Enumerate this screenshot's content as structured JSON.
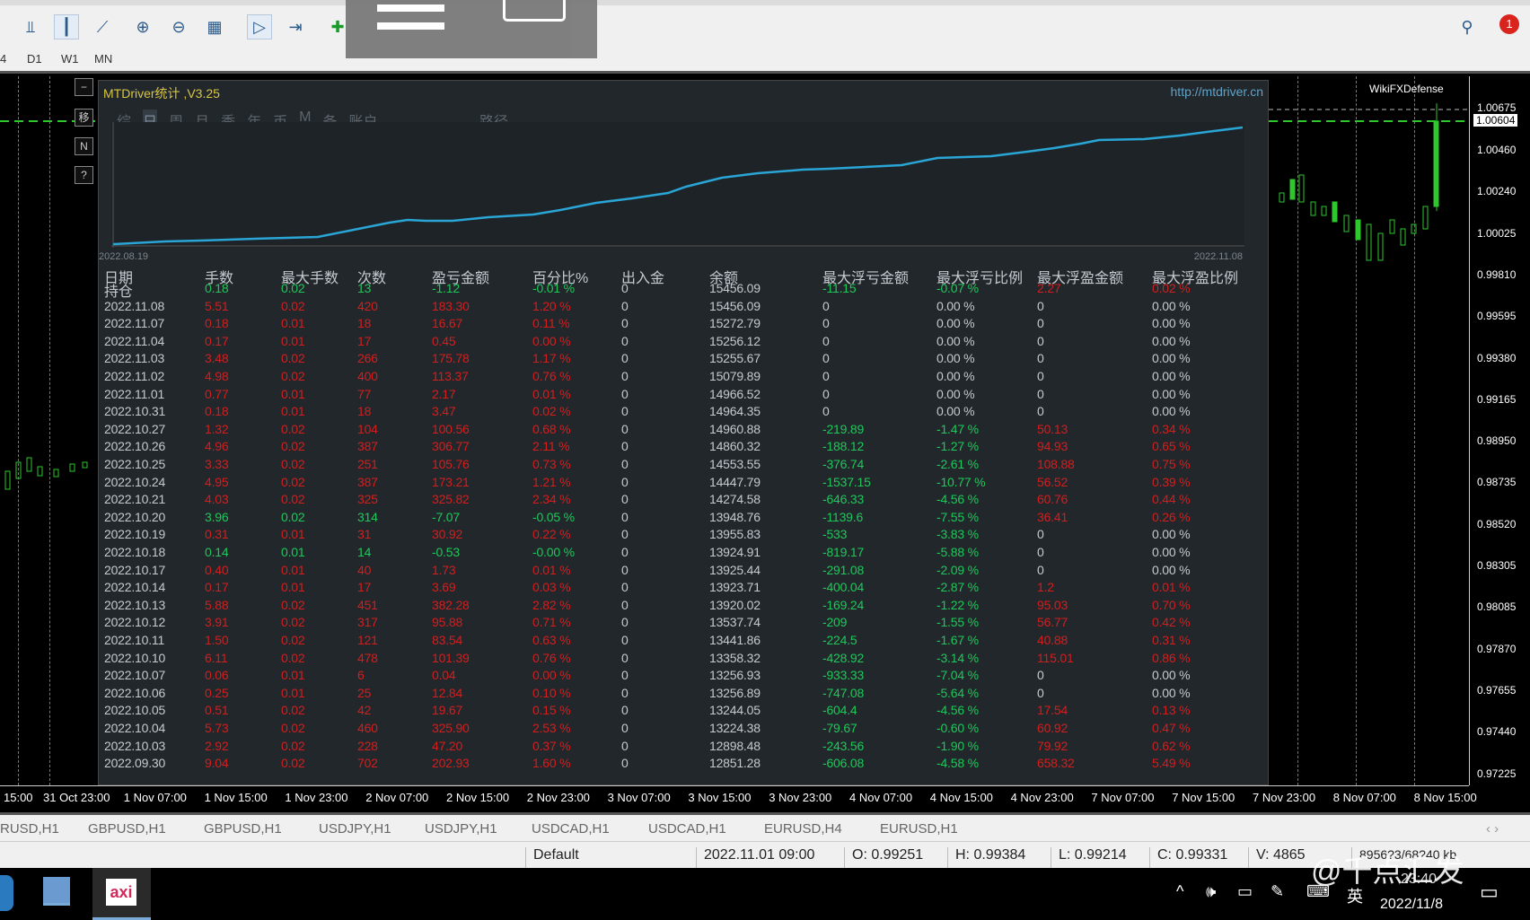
{
  "toolbar": {
    "timeframes": [
      "4",
      "D1",
      "W1",
      "MN"
    ],
    "notification_count": "1"
  },
  "panel": {
    "title": "MTDriver统计 ,V3.25",
    "url": "http://mtdriver.cn",
    "tabs": [
      "综",
      "日",
      "周",
      "月",
      "季",
      "年",
      "币",
      "M",
      "备",
      "账户"
    ],
    "selected_tab": "日",
    "path_label": "路径",
    "chart_start": "2022.08.19",
    "chart_end": "2022.11.08"
  },
  "chart_watermark": "WikiFXDefense",
  "price_axis": [
    "1.00675",
    "1.00604",
    "1.00460",
    "1.00240",
    "1.00025",
    "0.99810",
    "0.99595",
    "0.99380",
    "0.99165",
    "0.98950",
    "0.98735",
    "0.98520",
    "0.98305",
    "0.98085",
    "0.97870",
    "0.97655",
    "0.97440",
    "0.97225"
  ],
  "time_axis": [
    "15:00",
    "31 Oct 23:00",
    "1 Nov 07:00",
    "1 Nov 15:00",
    "1 Nov 23:00",
    "2 Nov 07:00",
    "2 Nov 15:00",
    "2 Nov 23:00",
    "3 Nov 07:00",
    "3 Nov 15:00",
    "3 Nov 23:00",
    "4 Nov 07:00",
    "4 Nov 15:00",
    "4 Nov 23:00",
    "7 Nov 07:00",
    "7 Nov 15:00",
    "7 Nov 23:00",
    "8 Nov 07:00",
    "8 Nov 15:00"
  ],
  "table": {
    "headers": [
      "日期",
      "手数",
      "最大手数",
      "次数",
      "盈亏金额",
      "百分比%",
      "出入金",
      "余额",
      "最大浮亏金额",
      "最大浮亏比例",
      "最大浮盈金额",
      "最大浮盈比例"
    ],
    "rows": [
      [
        "持仓",
        "0.18",
        "0.02",
        "13",
        "-1.12",
        "-0.01 %",
        "0",
        "15456.09",
        "-11.15",
        "-0.07 %",
        "2.27",
        "0.02 %"
      ],
      [
        "2022.11.08",
        "5.51",
        "0.02",
        "420",
        "183.30",
        "1.20 %",
        "0",
        "15456.09",
        "0",
        "0.00 %",
        "0",
        "0.00 %"
      ],
      [
        "2022.11.07",
        "0.18",
        "0.01",
        "18",
        "16.67",
        "0.11 %",
        "0",
        "15272.79",
        "0",
        "0.00 %",
        "0",
        "0.00 %"
      ],
      [
        "2022.11.04",
        "0.17",
        "0.01",
        "17",
        "0.45",
        "0.00 %",
        "0",
        "15256.12",
        "0",
        "0.00 %",
        "0",
        "0.00 %"
      ],
      [
        "2022.11.03",
        "3.48",
        "0.02",
        "266",
        "175.78",
        "1.17 %",
        "0",
        "15255.67",
        "0",
        "0.00 %",
        "0",
        "0.00 %"
      ],
      [
        "2022.11.02",
        "4.98",
        "0.02",
        "400",
        "113.37",
        "0.76 %",
        "0",
        "15079.89",
        "0",
        "0.00 %",
        "0",
        "0.00 %"
      ],
      [
        "2022.11.01",
        "0.77",
        "0.01",
        "77",
        "2.17",
        "0.01 %",
        "0",
        "14966.52",
        "0",
        "0.00 %",
        "0",
        "0.00 %"
      ],
      [
        "2022.10.31",
        "0.18",
        "0.01",
        "18",
        "3.47",
        "0.02 %",
        "0",
        "14964.35",
        "0",
        "0.00 %",
        "0",
        "0.00 %"
      ],
      [
        "2022.10.27",
        "1.32",
        "0.02",
        "104",
        "100.56",
        "0.68 %",
        "0",
        "14960.88",
        "-219.89",
        "-1.47 %",
        "50.13",
        "0.34 %"
      ],
      [
        "2022.10.26",
        "4.96",
        "0.02",
        "387",
        "306.77",
        "2.11 %",
        "0",
        "14860.32",
        "-188.12",
        "-1.27 %",
        "94.93",
        "0.65 %"
      ],
      [
        "2022.10.25",
        "3.33",
        "0.02",
        "251",
        "105.76",
        "0.73 %",
        "0",
        "14553.55",
        "-376.74",
        "-2.61 %",
        "108.88",
        "0.75 %"
      ],
      [
        "2022.10.24",
        "4.95",
        "0.02",
        "387",
        "173.21",
        "1.21 %",
        "0",
        "14447.79",
        "-1537.15",
        "-10.77 %",
        "56.52",
        "0.39 %"
      ],
      [
        "2022.10.21",
        "4.03",
        "0.02",
        "325",
        "325.82",
        "2.34 %",
        "0",
        "14274.58",
        "-646.33",
        "-4.56 %",
        "60.76",
        "0.44 %"
      ],
      [
        "2022.10.20",
        "3.96",
        "0.02",
        "314",
        "-7.07",
        "-0.05 %",
        "0",
        "13948.76",
        "-1139.6",
        "-7.55 %",
        "36.41",
        "0.26 %"
      ],
      [
        "2022.10.19",
        "0.31",
        "0.01",
        "31",
        "30.92",
        "0.22 %",
        "0",
        "13955.83",
        "-533",
        "-3.83 %",
        "0",
        "0.00 %"
      ],
      [
        "2022.10.18",
        "0.14",
        "0.01",
        "14",
        "-0.53",
        "-0.00 %",
        "0",
        "13924.91",
        "-819.17",
        "-5.88 %",
        "0",
        "0.00 %"
      ],
      [
        "2022.10.17",
        "0.40",
        "0.01",
        "40",
        "1.73",
        "0.01 %",
        "0",
        "13925.44",
        "-291.08",
        "-2.09 %",
        "0",
        "0.00 %"
      ],
      [
        "2022.10.14",
        "0.17",
        "0.01",
        "17",
        "3.69",
        "0.03 %",
        "0",
        "13923.71",
        "-400.04",
        "-2.87 %",
        "1.2",
        "0.01 %"
      ],
      [
        "2022.10.13",
        "5.88",
        "0.02",
        "451",
        "382.28",
        "2.82 %",
        "0",
        "13920.02",
        "-169.24",
        "-1.22 %",
        "95.03",
        "0.70 %"
      ],
      [
        "2022.10.12",
        "3.91",
        "0.02",
        "317",
        "95.88",
        "0.71 %",
        "0",
        "13537.74",
        "-209",
        "-1.55 %",
        "56.77",
        "0.42 %"
      ],
      [
        "2022.10.11",
        "1.50",
        "0.02",
        "121",
        "83.54",
        "0.63 %",
        "0",
        "13441.86",
        "-224.5",
        "-1.67 %",
        "40.88",
        "0.31 %"
      ],
      [
        "2022.10.10",
        "6.11",
        "0.02",
        "478",
        "101.39",
        "0.76 %",
        "0",
        "13358.32",
        "-428.92",
        "-3.14 %",
        "115.01",
        "0.86 %"
      ],
      [
        "2022.10.07",
        "0.06",
        "0.01",
        "6",
        "0.04",
        "0.00 %",
        "0",
        "13256.93",
        "-933.33",
        "-7.04 %",
        "0",
        "0.00 %"
      ],
      [
        "2022.10.06",
        "0.25",
        "0.01",
        "25",
        "12.84",
        "0.10 %",
        "0",
        "13256.89",
        "-747.08",
        "-5.64 %",
        "0",
        "0.00 %"
      ],
      [
        "2022.10.05",
        "0.51",
        "0.02",
        "42",
        "19.67",
        "0.15 %",
        "0",
        "13244.05",
        "-604.4",
        "-4.56 %",
        "17.54",
        "0.13 %"
      ],
      [
        "2022.10.04",
        "5.73",
        "0.02",
        "460",
        "325.90",
        "2.53 %",
        "0",
        "13224.38",
        "-79.67",
        "-0.60 %",
        "60.92",
        "0.47 %"
      ],
      [
        "2022.10.03",
        "2.92",
        "0.02",
        "228",
        "47.20",
        "0.37 %",
        "0",
        "12898.48",
        "-243.56",
        "-1.90 %",
        "79.92",
        "0.62 %"
      ],
      [
        "2022.09.30",
        "9.04",
        "0.02",
        "702",
        "202.93",
        "1.60 %",
        "0",
        "12851.28",
        "-606.08",
        "-4.58 %",
        "658.32",
        "5.49 %"
      ]
    ]
  },
  "symbol_tabs": [
    "RUSD,H1",
    "GBPUSD,H1",
    "GBPUSD,H1",
    "USDJPY,H1",
    "USDJPY,H1",
    "USDCAD,H1",
    "USDCAD,H1",
    "EURUSD,H4",
    "EURUSD,H1"
  ],
  "status": {
    "profile": "Default",
    "datetime": "2022.11.01 09:00",
    "open": "O: 0.99251",
    "high": "H: 0.99384",
    "low": "L: 0.99214",
    "close": "C: 0.99331",
    "volume": "V: 4865",
    "connection": "8956?3/68?40 kb"
  },
  "taskbar": {
    "time": "23:40",
    "date": "2022/11/8",
    "ime": "英",
    "app_label": "axi"
  },
  "watermark": "@千点汇发"
}
